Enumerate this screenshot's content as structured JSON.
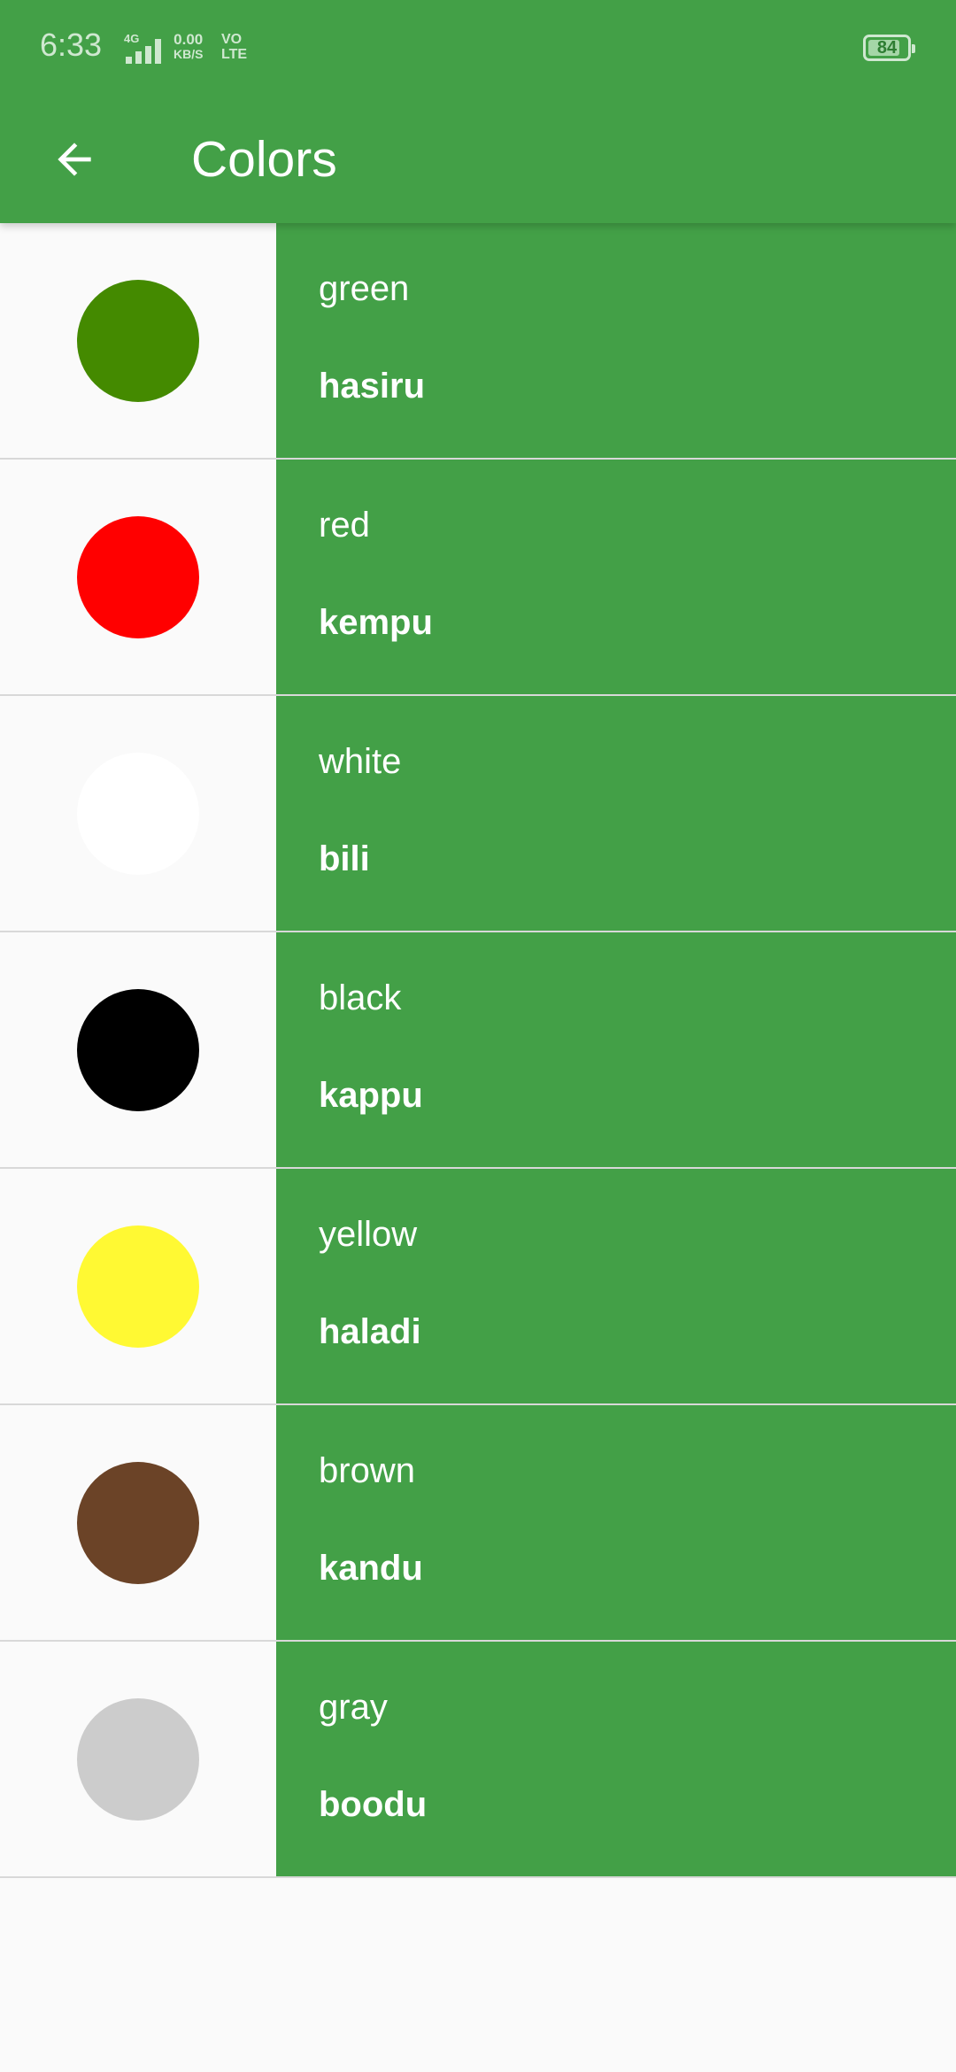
{
  "status_bar": {
    "time": "6:33",
    "network_type": "4G",
    "speed_value": "0.00",
    "speed_unit": "KB/S",
    "volte_top": "VO",
    "volte_bottom": "LTE",
    "battery_level": "84",
    "battery_fraction": 0.84
  },
  "toolbar": {
    "title": "Colors",
    "back_icon": "arrow-left-icon"
  },
  "colors": {
    "appbar": "#43a047",
    "text_panel": "#43a047",
    "background": "#fafafa",
    "divider": "#d8d8d8"
  },
  "items": [
    {
      "english": "green",
      "kannada": "hasiru",
      "swatch": "#448a00"
    },
    {
      "english": "red",
      "kannada": "kempu",
      "swatch": "#ff0000"
    },
    {
      "english": "white",
      "kannada": "bili",
      "swatch": "#ffffff"
    },
    {
      "english": "black",
      "kannada": "kappu",
      "swatch": "#000000"
    },
    {
      "english": "yellow",
      "kannada": "haladi",
      "swatch": "#fff933"
    },
    {
      "english": "brown",
      "kannada": "kandu",
      "swatch": "#6b4327"
    },
    {
      "english": "gray",
      "kannada": "boodu",
      "swatch": "#cccccc"
    }
  ]
}
